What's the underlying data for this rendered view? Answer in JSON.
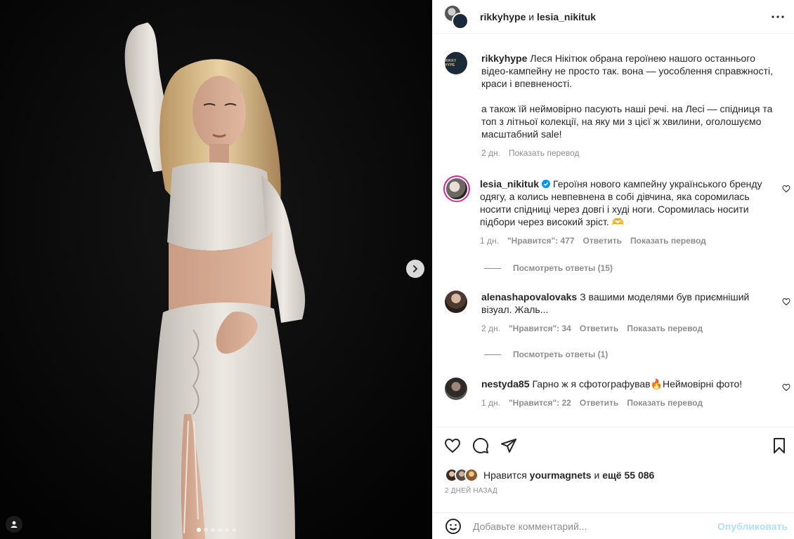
{
  "header": {
    "user1": "rikkyhype",
    "conjunction": "и",
    "user2": "lesia_nikituk",
    "rikky_logo_text": "RIKKY HYPE"
  },
  "caption": {
    "username": "rikkyhype",
    "text_p1": "Леся Нікітюк обрана героїнею нашого останнього відео-кампейну не просто так. вона — уособлення справжності, краси і впевненості.",
    "text_p2": "а також їй неймовірно пасують наші речі. на Лесі — спідниця та топ з літньої колекції, на яку ми з цієї ж хвилини, оголошуємо масштабний sale!",
    "time": "2 дн.",
    "translate": "Показать перевод"
  },
  "comments": [
    {
      "username": "lesia_nikituk",
      "verified": true,
      "text": "Героїня нового кампейну українського бренду одягу, а колись невпевнена в собі дівчина, яка соромилась носити спідниці через довгі і худі ноги. Соромилась носити підбори через високий зріст. 🫶",
      "time": "1 дн.",
      "likes": "\"Нравится\": 477",
      "reply": "Ответить",
      "translate": "Показать перевод",
      "view_replies": "Посмотреть ответы (15)"
    },
    {
      "username": "alenashapovalovaks",
      "text": "З вашими моделями був приємніший візуал. Жаль...",
      "time": "2 дн.",
      "likes": "\"Нравится\": 34",
      "reply": "Ответить",
      "translate": "Показать перевод",
      "view_replies": "Посмотреть ответы (1)"
    },
    {
      "username": "nestyda85",
      "text": "Гарно ж я сфотографував🔥Неймовірні фото!",
      "time": "1 дн.",
      "likes": "\"Нравится\": 22",
      "reply": "Ответить",
      "translate": "Показать перевод"
    }
  ],
  "likes": {
    "prefix": "Нравится",
    "user": "yourmagnets",
    "middle": "и",
    "count": "ещё 55 086"
  },
  "post_date": "2 ДНЕЙ НАЗАД",
  "comment_box": {
    "placeholder": "Добавьте комментарий...",
    "publish": "Опубликовать"
  },
  "carousel": {
    "total_slides": 6,
    "current_slide": 1
  },
  "icons": {
    "more": "more-horizontal-icon",
    "like": "heart-icon",
    "comment": "comment-icon",
    "share": "paper-plane-icon",
    "save": "bookmark-icon",
    "emoji": "emoji-icon",
    "next": "chevron-right-icon",
    "tag": "user-tag-icon"
  },
  "colors": {
    "verified": "#0095f6",
    "publish_disabled": "#b2dffc",
    "secondary_text": "#8e8e8e"
  }
}
